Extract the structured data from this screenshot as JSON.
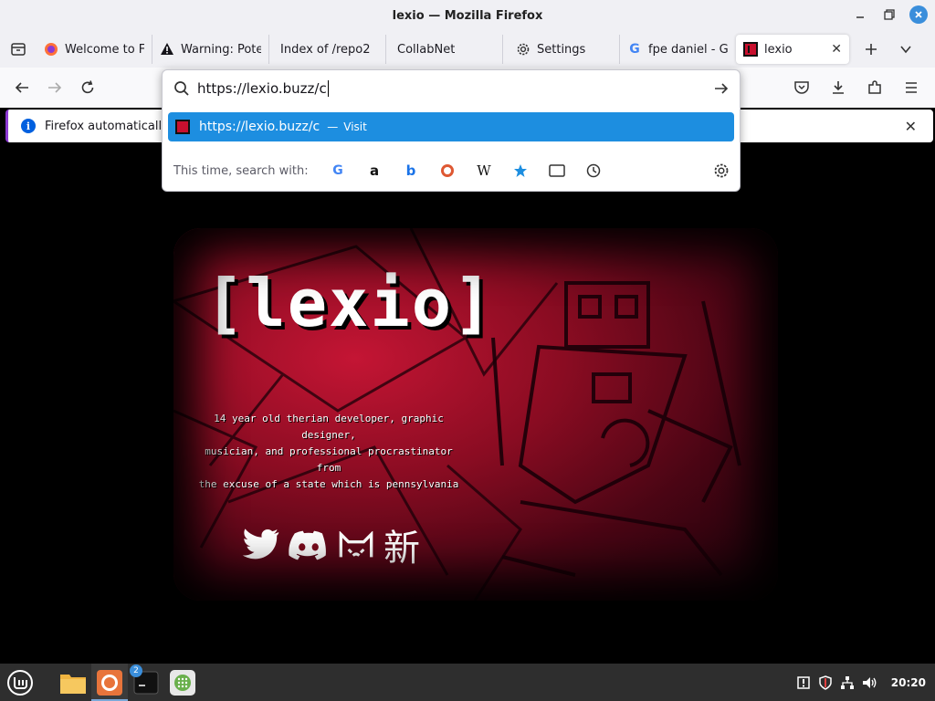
{
  "window": {
    "title": "lexio — Mozilla Firefox"
  },
  "tabs": [
    {
      "label": "Welcome to F",
      "icon": "firefox-icon"
    },
    {
      "label": "Warning: Pote",
      "icon": "warning-icon"
    },
    {
      "label": "Index of /repo2",
      "icon": ""
    },
    {
      "label": "CollabNet",
      "icon": ""
    },
    {
      "label": "Settings",
      "icon": "gear-icon"
    },
    {
      "label": "fpe daniel - Go",
      "icon": "google-icon"
    },
    {
      "label": "lexio",
      "icon": "lexio-favicon",
      "active": true
    }
  ],
  "urlbar": {
    "value": "https://lexio.buzz/c",
    "suggestion_url": "https://lexio.buzz/c",
    "suggestion_sep": "—",
    "suggestion_action": "Visit",
    "engines_label": "This time, search with:",
    "engines": [
      "google",
      "amazon",
      "bing",
      "duckduckgo",
      "wikipedia",
      "bookmarks",
      "tabs",
      "history"
    ]
  },
  "notification": {
    "text": "Firefox automatically s"
  },
  "page": {
    "logo": "[lexio]",
    "tagline": [
      "14 year old therian developer, graphic designer,",
      "musician, and professional procrastinator from",
      "the excuse of a state which is pennsylvania"
    ],
    "kanji": "新"
  },
  "taskbar": {
    "terminal_badge": "2",
    "clock": "20:20"
  },
  "colors": {
    "accent": "#1d8ee0",
    "hero_red": "#c41534",
    "notif_border": "#8d3ad3"
  }
}
